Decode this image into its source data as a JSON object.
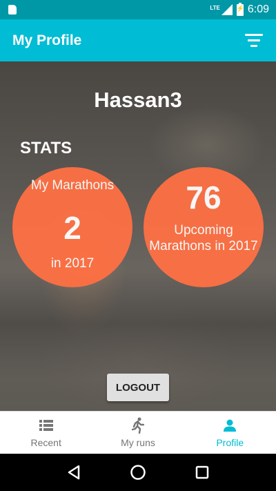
{
  "status_bar": {
    "network": "LTE",
    "time": "6:09",
    "icons": [
      "sd-card-icon",
      "signal-icon",
      "battery-charging-icon"
    ]
  },
  "app_bar": {
    "title": "My Profile",
    "filter_icon": "filter-icon"
  },
  "profile": {
    "username": "Hassan3",
    "stats_heading": "STATS"
  },
  "stats": {
    "my_marathons": {
      "label_top": "My Marathons",
      "value": "2",
      "label_bottom": "in 2017"
    },
    "upcoming_marathons": {
      "value": "76",
      "label": "Upcoming Marathons in 2017"
    }
  },
  "logout_label": "LOGOUT",
  "bottom_nav": {
    "items": [
      {
        "label": "Recent",
        "icon": "list-icon",
        "active": false
      },
      {
        "label": "My runs",
        "icon": "running-icon",
        "active": false
      },
      {
        "label": "Profile",
        "icon": "person-icon",
        "active": true
      }
    ]
  },
  "system_nav": [
    "back-icon",
    "home-icon",
    "recents-icon"
  ],
  "colors": {
    "status_bar": "#0097a7",
    "app_bar": "#00bcd4",
    "stat_circle": "#ff7043",
    "nav_active": "#00bcd4",
    "nav_inactive": "#757575"
  }
}
